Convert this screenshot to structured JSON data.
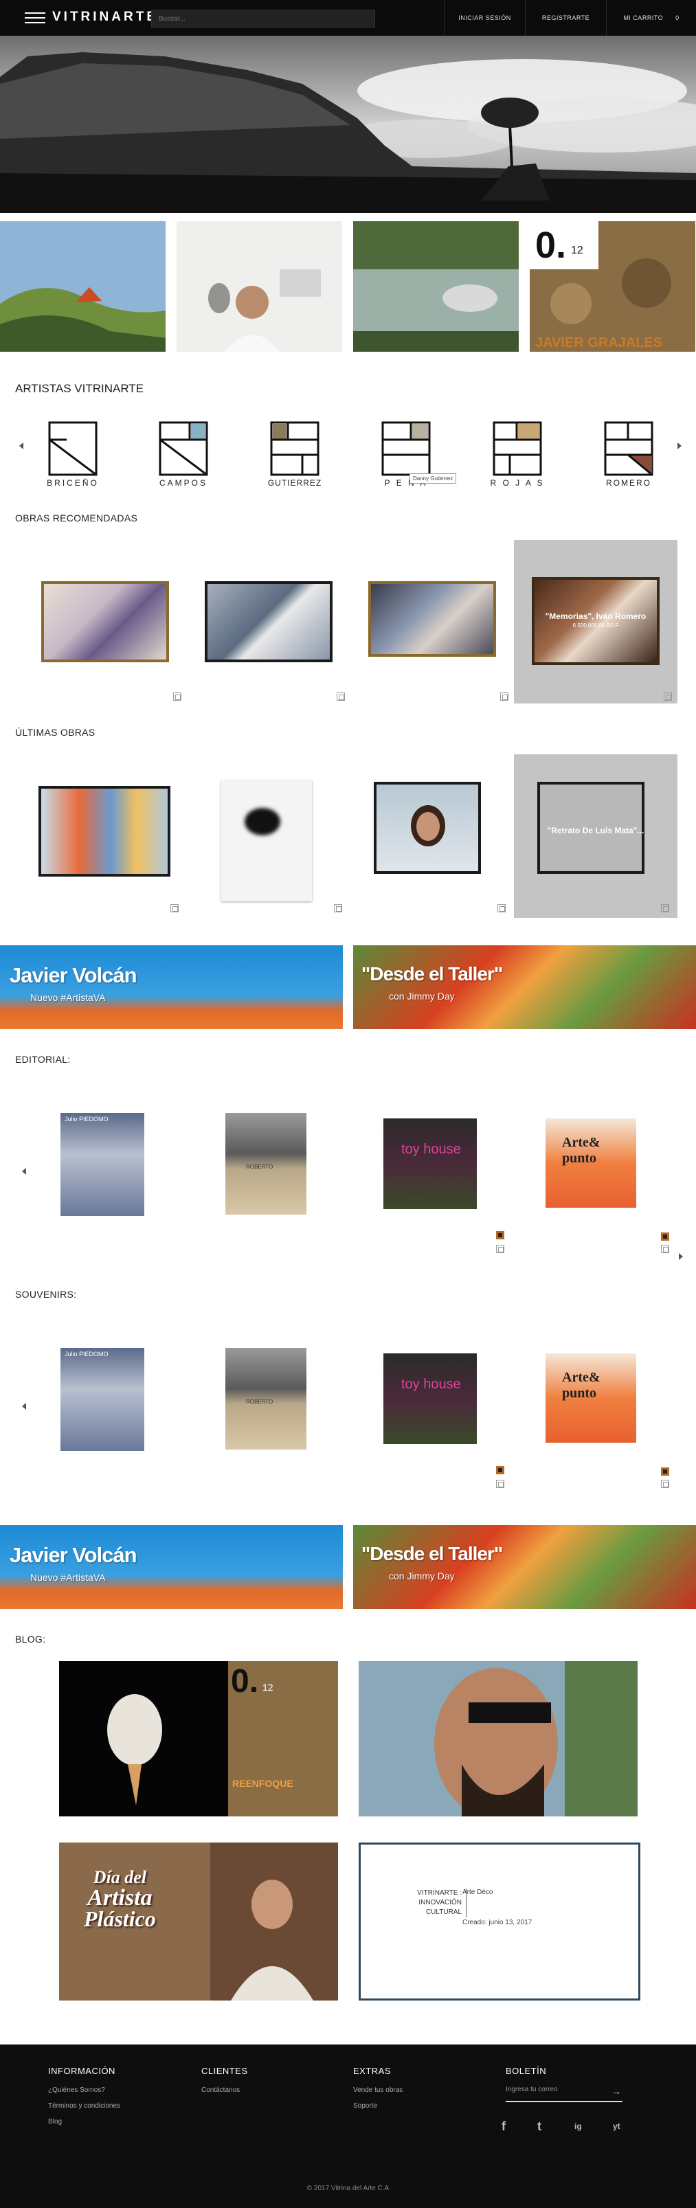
{
  "header": {
    "logo": "VITRINARTE",
    "search_placeholder": "Buscar...",
    "login": "INICIAR SESIÓN",
    "register": "REGISTRARTE",
    "cart": "MI CARRITO",
    "cart_count": "0"
  },
  "promo": {
    "tile4_number": "0.",
    "tile4_sub": "12",
    "tile4_name": "JAVIER GRAJALES"
  },
  "artists": {
    "title": "ARTISTAS VITRINARTE",
    "items": [
      "BRICEÑO",
      "CAMPOS",
      "GUTIERREZ",
      "P E Ñ A",
      "R O J A S",
      "ROMERO"
    ],
    "tooltip": "Danny Gutierrez"
  },
  "recommended": {
    "title": "OBRAS RECOMENDADAS",
    "hover_caption": "\"Memorias\", Iván Romero",
    "hover_price": "6.500.000,00 BS.F"
  },
  "latest": {
    "title": "ÚLTIMAS OBRAS",
    "hover_caption": "\"Retrato De Luis Mata\"..."
  },
  "banners": {
    "volcan_title": "Javier Volcán",
    "volcan_sub": "Nuevo #ArtistaVA",
    "taller_title": "\"Desde el Taller\"",
    "taller_sub": "con Jimmy Day"
  },
  "editorial": {
    "title": "EDITORIAL:",
    "books": [
      {
        "title": "Julio PIEDOMO"
      },
      {
        "title": "ROBERTO"
      },
      {
        "title": "toy house"
      },
      {
        "title": "Arte& punto"
      }
    ]
  },
  "souvenirs": {
    "title": "SOUVENIRS:"
  },
  "blog": {
    "title": "BLOG:",
    "post1_number": "0.",
    "post1_sub": "12",
    "post1_tag": "REENFOQUE",
    "post3_line1": "Día del",
    "post3_line2": "Artista",
    "post3_line3": "Plástico",
    "card_tag": "VITRINARTE : INNOVACIÓN CULTURAL",
    "card_title": "Arte Déco",
    "card_date": "Creado: junio 13, 2017"
  },
  "footer": {
    "col1_title": "INFORMACIÓN",
    "col1_links": [
      "¿Quiénes Somos?",
      "Términos y condiciones",
      "Blog"
    ],
    "col2_title": "CLIENTES",
    "col2_links": [
      "Contáctanos"
    ],
    "col3_title": "EXTRAS",
    "col3_links": [
      "Vende tus obras",
      "Soporte"
    ],
    "col4_title": "BOLETÍN",
    "newsletter_placeholder": "Ingresa tu correo",
    "newsletter_arrow": "→",
    "social": [
      "f",
      "t",
      "ig",
      "yt"
    ],
    "copyright": "© 2017 Vitrina del Arte C.A"
  }
}
